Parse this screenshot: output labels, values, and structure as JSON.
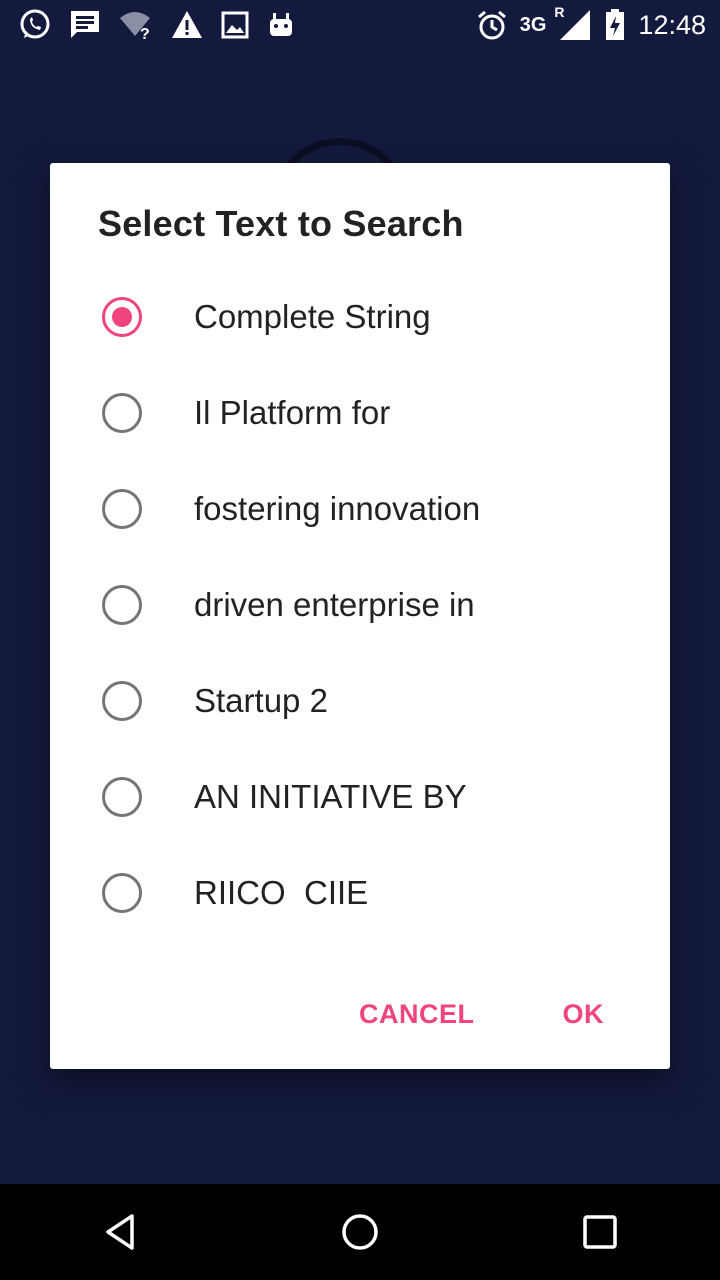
{
  "status_bar": {
    "left_icons": [
      "whatsapp-icon",
      "message-icon",
      "wifi-question-icon",
      "warning-icon",
      "image-icon",
      "android-icon"
    ],
    "alarm_icon": "alarm-icon",
    "network": "3G",
    "roaming": "R",
    "time": "12:48"
  },
  "dialog": {
    "title": "Select Text to Search",
    "options": [
      {
        "label": "Complete String",
        "selected": true
      },
      {
        "label": "Il Platform for",
        "selected": false
      },
      {
        "label": "fostering innovation",
        "selected": false
      },
      {
        "label": "driven enterprise in",
        "selected": false
      },
      {
        "label": "Startup 2",
        "selected": false
      },
      {
        "label": "AN INITIATIVE BY",
        "selected": false
      },
      {
        "label": "RIICO  CIIE",
        "selected": false
      }
    ],
    "cancel_label": "CANCEL",
    "ok_label": "OK"
  },
  "colors": {
    "accent": "#f0457c",
    "background": "#141a3e",
    "dialog": "#ffffff"
  },
  "nav_bar": {
    "icons": [
      "back-icon",
      "home-icon",
      "recents-icon"
    ]
  }
}
